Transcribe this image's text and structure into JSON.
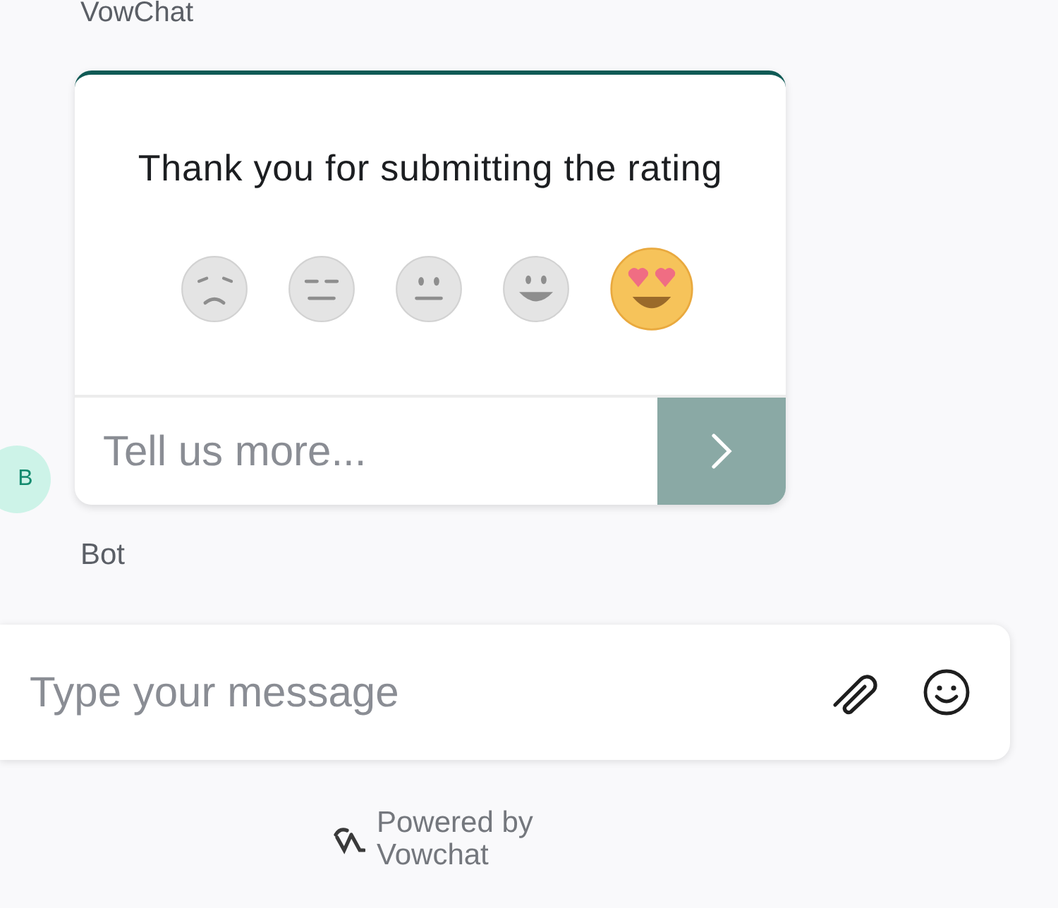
{
  "sender_top": "VowChat",
  "rating_card": {
    "title": "Thank you for submitting the rating",
    "ratings": [
      {
        "kind": "sad",
        "selected": false
      },
      {
        "kind": "expressionless",
        "selected": false
      },
      {
        "kind": "neutral",
        "selected": false
      },
      {
        "kind": "grinning",
        "selected": false
      },
      {
        "kind": "heart-eyes",
        "selected": true
      }
    ],
    "feedback": {
      "placeholder": "Tell us more..."
    }
  },
  "avatar": "B",
  "sender_bottom": "Bot",
  "composer": {
    "placeholder": "Type your message"
  },
  "footer": {
    "line1": "Powered by",
    "line2": "Vowchat"
  }
}
